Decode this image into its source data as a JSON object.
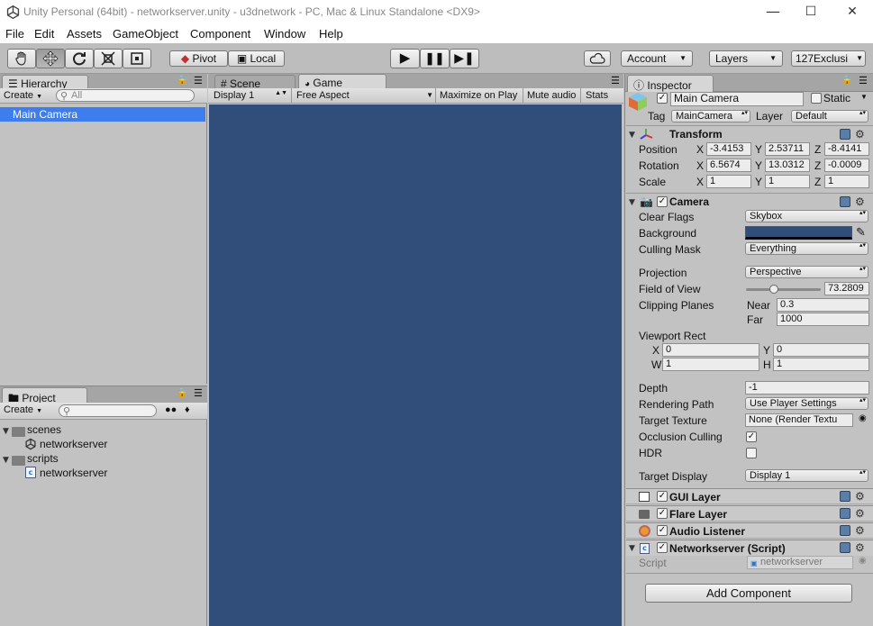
{
  "window": {
    "title": "Unity Personal (64bit) - networkserver.unity - u3dnetwork - PC, Mac & Linux Standalone <DX9>",
    "minimize": "—",
    "maximize": "☐",
    "close": "✕"
  },
  "menu": [
    "File",
    "Edit",
    "Assets",
    "GameObject",
    "Component",
    "Window",
    "Help"
  ],
  "toolbar": {
    "pivot": "Pivot",
    "local": "Local",
    "account": "Account",
    "layers": "Layers",
    "layout": "127Exclusi"
  },
  "hierarchy": {
    "tab": "Hierarchy",
    "create": "Create",
    "search_placeholder": "All",
    "items": [
      "Main Camera"
    ]
  },
  "scene_tab": "Scene",
  "game": {
    "tab": "Game",
    "display": "Display 1",
    "aspect": "Free Aspect",
    "maximize": "Maximize on Play",
    "mute": "Mute audio",
    "stats": "Stats",
    "background": "#314d79"
  },
  "project": {
    "tab": "Project",
    "create": "Create",
    "tree": [
      {
        "label": "scenes",
        "type": "folder"
      },
      {
        "label": "networkserver",
        "type": "scene"
      },
      {
        "label": "scripts",
        "type": "folder"
      },
      {
        "label": "networkserver",
        "type": "script"
      }
    ]
  },
  "inspector": {
    "tab": "Inspector",
    "object_name": "Main Camera",
    "static_label": "Static",
    "tag_label": "Tag",
    "tag_value": "MainCamera",
    "layer_label": "Layer",
    "layer_value": "Default",
    "transform": {
      "title": "Transform",
      "position_label": "Position",
      "rotation_label": "Rotation",
      "scale_label": "Scale",
      "position": [
        "-3.4153",
        "2.53711",
        "-8.4141"
      ],
      "rotation": [
        "6.5674",
        "13.0312",
        "-0.0009"
      ],
      "scale": [
        "1",
        "1",
        "1"
      ],
      "x": "X",
      "y": "Y",
      "z": "Z"
    },
    "camera": {
      "title": "Camera",
      "clear_flags_label": "Clear Flags",
      "clear_flags": "Skybox",
      "background_label": "Background",
      "background_color": "#314d79",
      "culling_mask_label": "Culling Mask",
      "culling_mask": "Everything",
      "projection_label": "Projection",
      "projection": "Perspective",
      "fov_label": "Field of View",
      "fov": "73.2809",
      "fov_fraction": 0.37,
      "clipping_label": "Clipping Planes",
      "near_label": "Near",
      "near": "0.3",
      "far_label": "Far",
      "far": "1000",
      "viewport_label": "Viewport Rect",
      "vx_label": "X",
      "vx": "0",
      "vy_label": "Y",
      "vy": "0",
      "vw_label": "W",
      "vw": "1",
      "vh_label": "H",
      "vh": "1",
      "depth_label": "Depth",
      "depth": "-1",
      "rendering_path_label": "Rendering Path",
      "rendering_path": "Use Player Settings",
      "target_texture_label": "Target Texture",
      "target_texture": "None (Render Textu",
      "occlusion_label": "Occlusion Culling",
      "occlusion": true,
      "hdr_label": "HDR",
      "hdr": false,
      "target_display_label": "Target Display",
      "target_display": "Display 1"
    },
    "components": [
      {
        "name": "GUI Layer"
      },
      {
        "name": "Flare Layer"
      },
      {
        "name": "Audio Listener"
      },
      {
        "name": "Networkserver (Script)"
      }
    ],
    "script_label": "Script",
    "script_value": "networkserver",
    "add_component": "Add Component"
  }
}
